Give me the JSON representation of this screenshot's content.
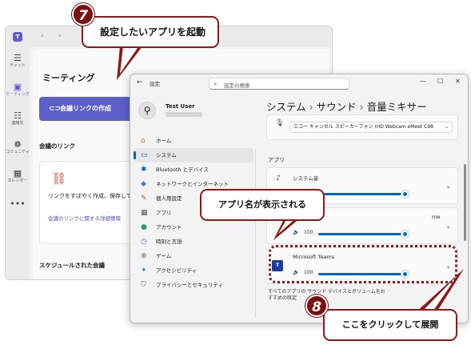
{
  "teams": {
    "rail": [
      {
        "icon": "chat-icon",
        "glyph": "☰",
        "label": "チャット"
      },
      {
        "icon": "meeting-icon",
        "glyph": "▣",
        "label": "ミーティング"
      },
      {
        "icon": "contacts-icon",
        "glyph": "☷",
        "label": "連絡先"
      },
      {
        "icon": "community-icon",
        "glyph": "☸",
        "label": "コミュニティ"
      },
      {
        "icon": "calendar-icon",
        "glyph": "▦",
        "label": "カレンダー"
      }
    ],
    "more_glyph": "•••",
    "logo_glyph": "T",
    "back_glyph": "‹",
    "forward_glyph": "›",
    "title": "ミーティング",
    "create_link_label": "会議リンクの作成",
    "link_glyph": "⊂⊃",
    "meeting_links_heading": "会議のリンク",
    "link_card_text": "リンクをすばやく作成、保存して",
    "link_card_more": "会議のリンクに関する詳細情報",
    "scheduled_heading": "スケジュールされた会議"
  },
  "settings": {
    "back_glyph": "←",
    "app_title": "設定",
    "search_icon": "⌕",
    "search_placeholder": "設定の検索",
    "window_controls": [
      "—",
      "☐",
      "✕"
    ],
    "user_name": "Test User",
    "avatar_glyph": "⚲",
    "nav": [
      {
        "label": "ホーム",
        "icon": "home-icon",
        "glyph": "⌂",
        "color": "#d87a2a"
      },
      {
        "label": "システム",
        "icon": "system-icon",
        "glyph": "▭",
        "color": "#0067c0",
        "active": true
      },
      {
        "label": "Bluetooth とデバイス",
        "icon": "bluetooth-icon",
        "glyph": "✱",
        "color": "#0067c0"
      },
      {
        "label": "ネットワークとインターネット",
        "icon": "network-icon",
        "glyph": "◆",
        "color": "#3a7fd5"
      },
      {
        "label": "個人用設定",
        "icon": "personalize-icon",
        "glyph": "✎",
        "color": "#c0622a"
      },
      {
        "label": "アプリ",
        "icon": "apps-icon",
        "glyph": "▦",
        "color": "#555555"
      },
      {
        "label": "アカウント",
        "icon": "account-icon",
        "glyph": "●",
        "color": "#2a9a6a"
      },
      {
        "label": "時刻と言語",
        "icon": "time-icon",
        "glyph": "◷",
        "color": "#3a7fd5"
      },
      {
        "label": "ゲーム",
        "icon": "game-icon",
        "glyph": "⊕",
        "color": "#666666"
      },
      {
        "label": "アクセシビリティ",
        "icon": "accessibility-icon",
        "glyph": "✦",
        "color": "#3a7fd5"
      },
      {
        "label": "プライバシーとセキュリティ",
        "icon": "shield-icon",
        "glyph": "⛉",
        "color": "#666666"
      }
    ],
    "breadcrumb": [
      "システム",
      "サウンド",
      "音量ミキサー"
    ],
    "breadcrumb_sep": "›",
    "mic_glyph": "🎙",
    "mic_device": "エコー キャンセル スピーカーフォン (HD Webcam eMeet C98",
    "chevron_glyph": "⌄",
    "apps_heading": "アプリ",
    "apps": [
      {
        "name": "システム音",
        "icon": "speaker-icon",
        "glyph": "♪",
        "volume_glyph": "🔈",
        "volume": "",
        "level": 1.0
      },
      {
        "name": "me",
        "icon": "chrome-icon",
        "glyph": "◉",
        "volume_glyph": "🔈",
        "volume": "100",
        "level": 1.0
      },
      {
        "name": "Microsoft Teams",
        "icon": "teams-icon",
        "glyph": "T",
        "volume_glyph": "🔈",
        "volume": "100",
        "level": 1.0
      }
    ],
    "reset_text": "すべてのアプリの サウンド デバイスとボリュームをお すすめの既定"
  },
  "annotations": {
    "step7": "7",
    "step7_text": "設定したいアプリを起動",
    "step_mid_text": "アプリ名が表示される",
    "step8": "8",
    "step8_text": "ここをクリックして展開"
  },
  "colors": {
    "accent": "#0067c0",
    "teams_purple": "#5b5fc7",
    "annotation": "#8b1a1a"
  }
}
